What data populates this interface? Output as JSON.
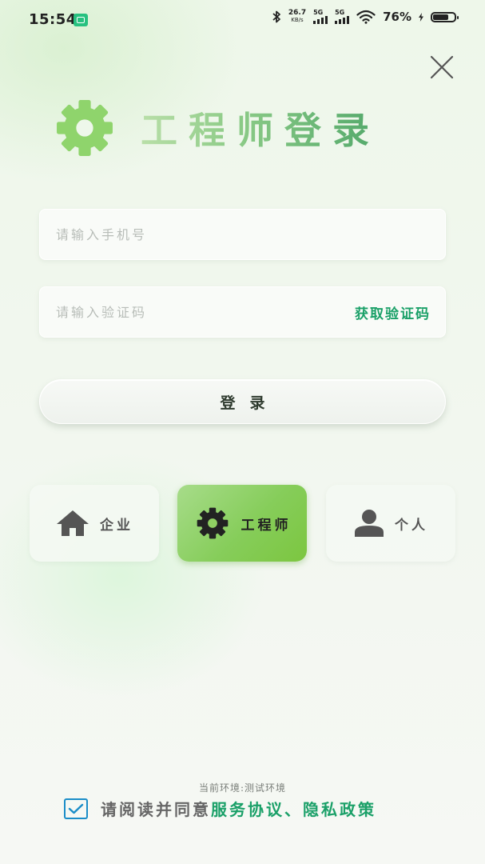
{
  "status_bar": {
    "time": "15:54",
    "net_speed_value": "26.7",
    "net_speed_unit": "KB/s",
    "sim1_label": "5G",
    "sim2_label": "5G",
    "battery_percent": "76%",
    "battery_level": 0.76
  },
  "header": {
    "title": "工程师登录"
  },
  "form": {
    "phone_placeholder": "请输入手机号",
    "code_placeholder": "请输入验证码",
    "get_code_label": "获取验证码",
    "login_label": "登录"
  },
  "roles": {
    "selected": "engineer",
    "company_label": "企业",
    "engineer_label": "工程师",
    "personal_label": "个人"
  },
  "footer": {
    "env_text": "当前环境:测试环境",
    "agree_prefix": "请阅读并同意",
    "agree_links": "服务协议、隐私政策",
    "agree_checked": true
  },
  "colors": {
    "accent_green": "#1aa068",
    "selected_role_green": "#86cd5a",
    "checkbox_blue": "#1a8dc8"
  }
}
